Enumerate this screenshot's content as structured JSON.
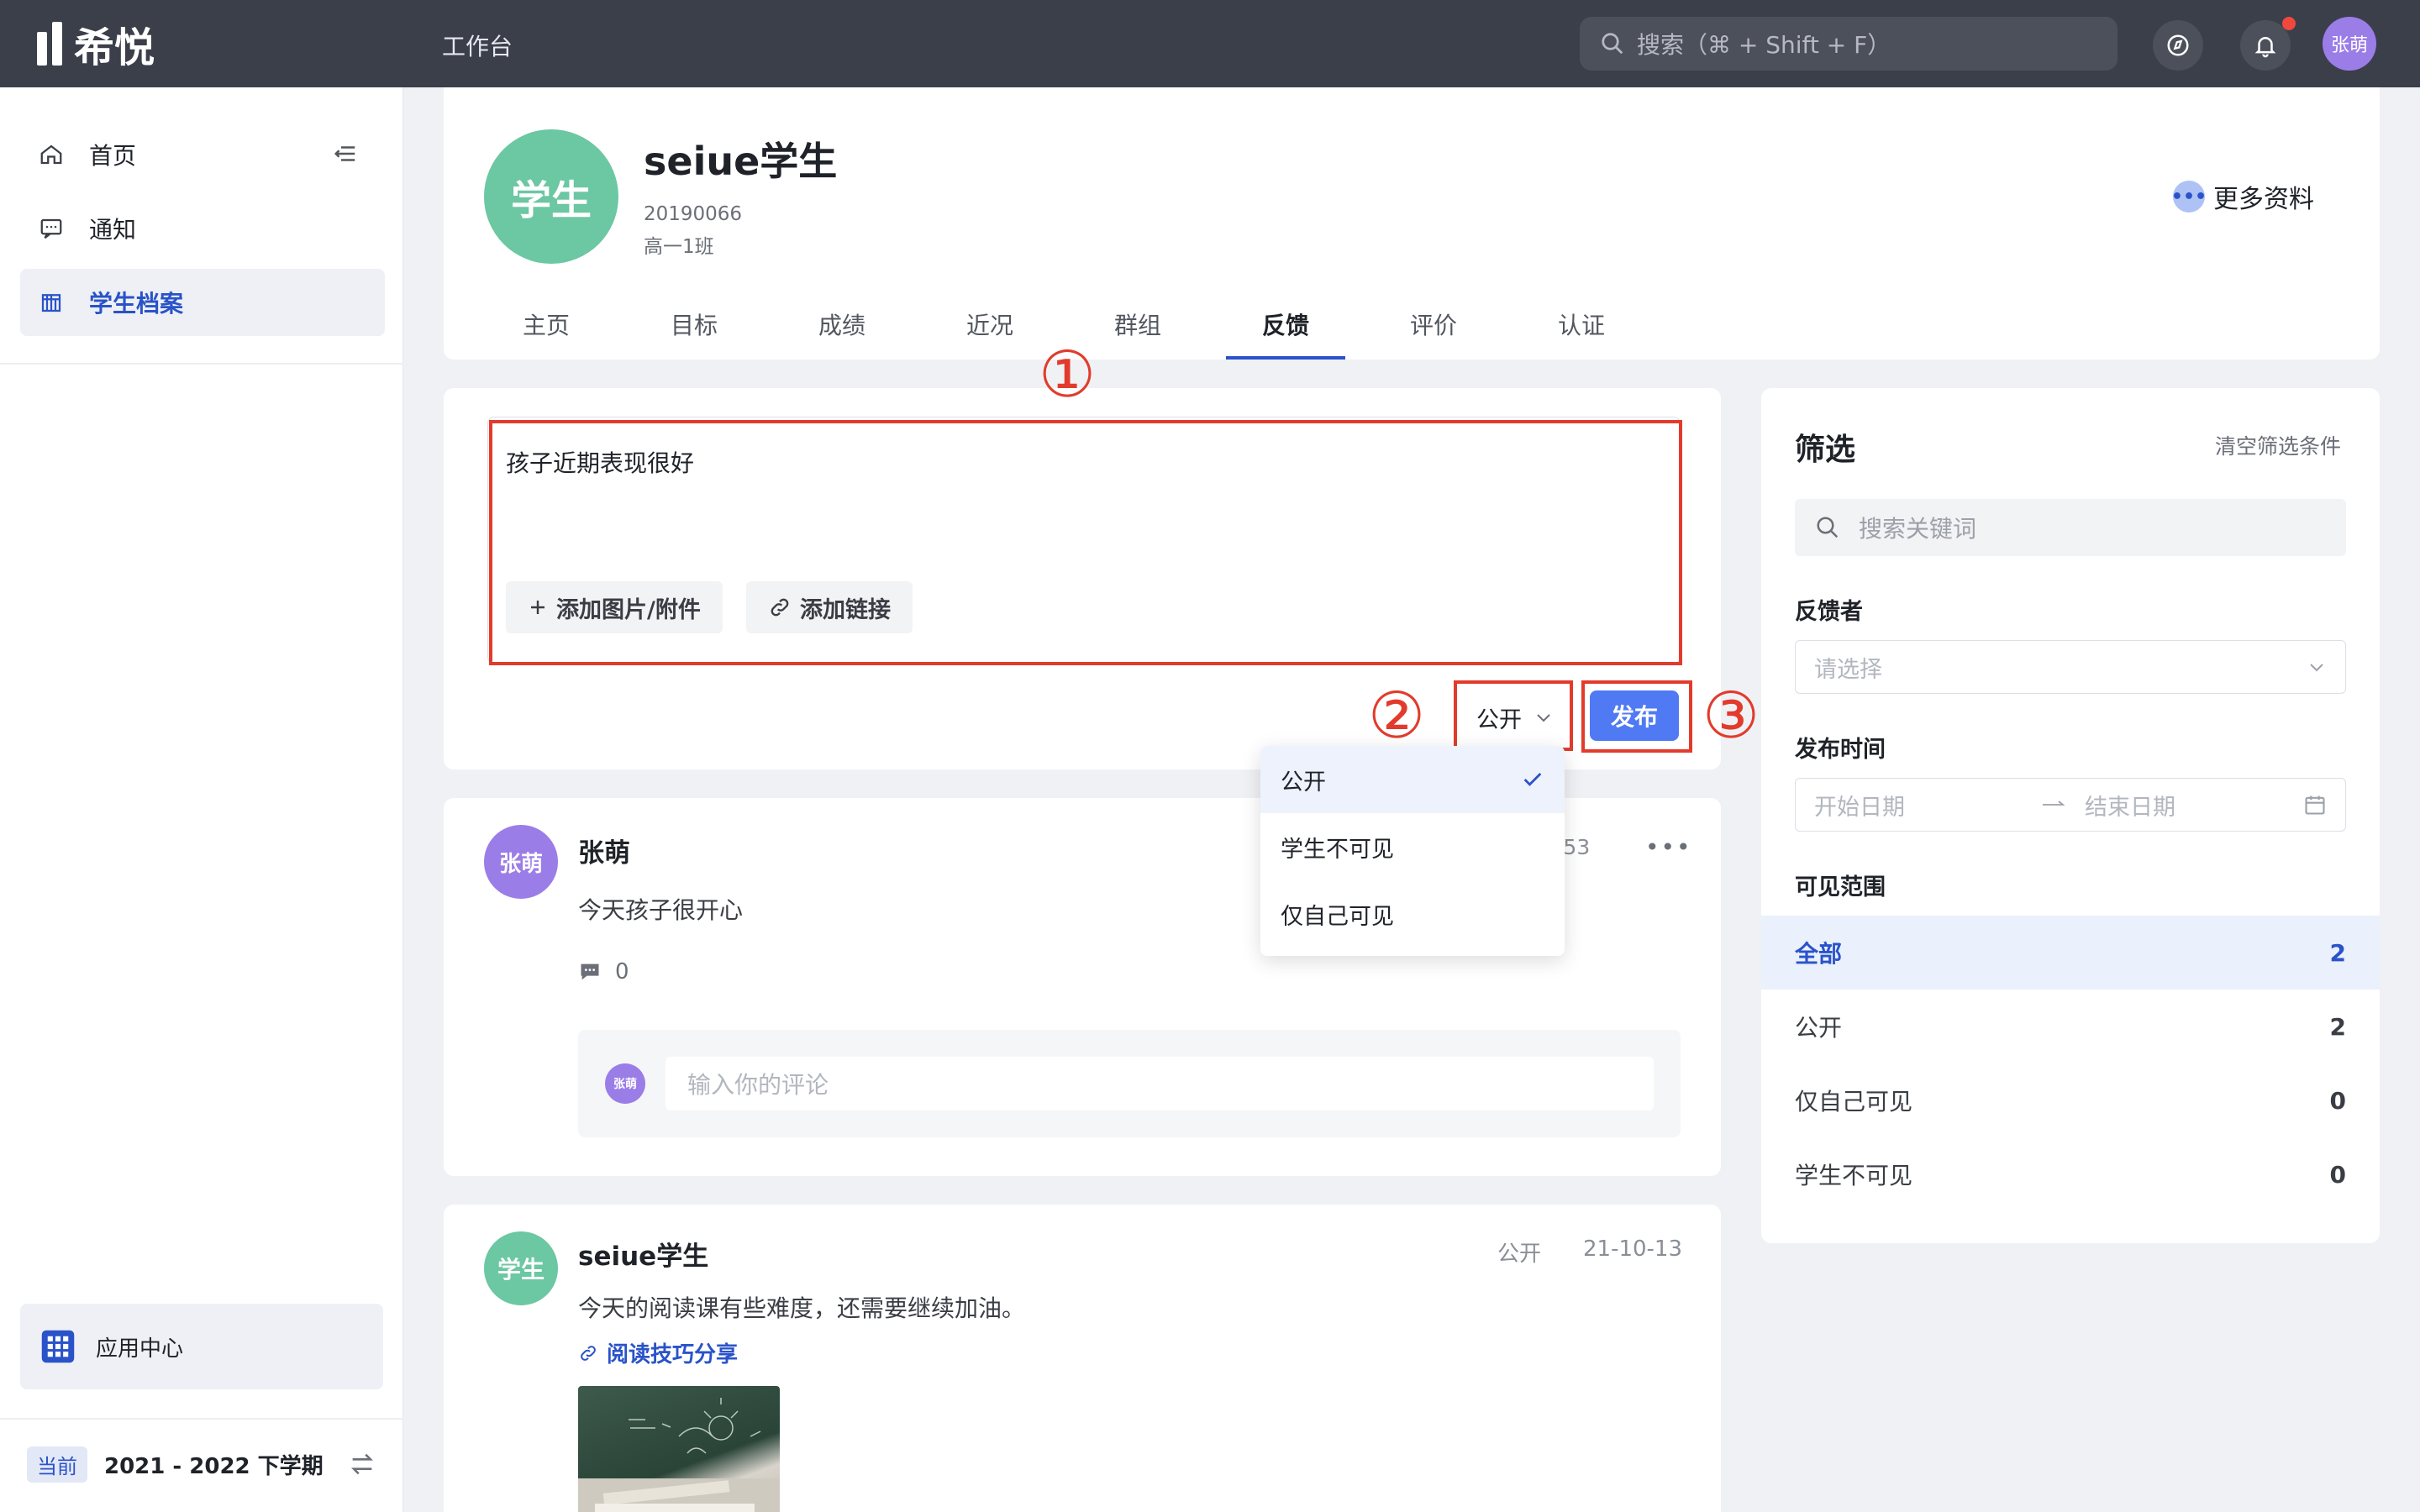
{
  "header": {
    "app_name": "希悦",
    "workbench": "工作台",
    "search_placeholder": "搜索（⌘ + Shift + F）",
    "user_avatar": "张萌"
  },
  "sidebar": {
    "items": [
      {
        "label": "首页",
        "icon": "home-icon"
      },
      {
        "label": "通知",
        "icon": "message-icon"
      },
      {
        "label": "学生档案",
        "icon": "archive-icon",
        "active": true
      }
    ],
    "app_center": "应用中心",
    "term_badge": "当前",
    "term": "2021 - 2022 下学期"
  },
  "profile": {
    "avatar_text": "学生",
    "name": "seiue学生",
    "student_id": "20190066",
    "class_name": "高一1班",
    "more_info": "更多资料",
    "tabs": [
      "主页",
      "目标",
      "成绩",
      "近况",
      "群组",
      "反馈",
      "评价",
      "认证"
    ],
    "active_tab": "反馈"
  },
  "editor": {
    "text": "孩子近期表现很好",
    "add_attachment": "添加图片/附件",
    "add_link": "添加链接",
    "visibility": "公开",
    "publish": "发布",
    "markers": [
      "①",
      "②",
      "③"
    ]
  },
  "dropdown": {
    "options": [
      "公开",
      "学生不可见",
      "仅自己可见"
    ],
    "selected": "公开"
  },
  "feed": [
    {
      "avatar": "张萌",
      "author": "张萌",
      "time_partial": ":53",
      "content": "今天孩子很开心",
      "comment_count": "0",
      "comment_avatar": "张萌",
      "comment_placeholder": "输入你的评论"
    },
    {
      "avatar": "学生",
      "author": "seiue学生",
      "visibility": "公开",
      "date": "21-10-13",
      "content": "今天的阅读课有些难度，还需要继续加油。",
      "link": "阅读技巧分享"
    }
  ],
  "filter": {
    "title": "筛选",
    "clear": "清空筛选条件",
    "search_placeholder": "搜索关键词",
    "reviewer_label": "反馈者",
    "reviewer_placeholder": "请选择",
    "time_label": "发布时间",
    "start_placeholder": "开始日期",
    "end_placeholder": "结束日期",
    "scope_label": "可见范围",
    "scopes": [
      {
        "label": "全部",
        "count": "2",
        "active": true
      },
      {
        "label": "公开",
        "count": "2"
      },
      {
        "label": "仅自己可见",
        "count": "0"
      },
      {
        "label": "学生不可见",
        "count": "0"
      }
    ]
  },
  "colors": {
    "topbar": "#3b3f4a",
    "accent": "#2a53c9",
    "publish_button": "#4f7af3",
    "annotation_red": "#e23b2c",
    "student_avatar": "#6cc7a3",
    "user_avatar": "#9b7de8"
  }
}
